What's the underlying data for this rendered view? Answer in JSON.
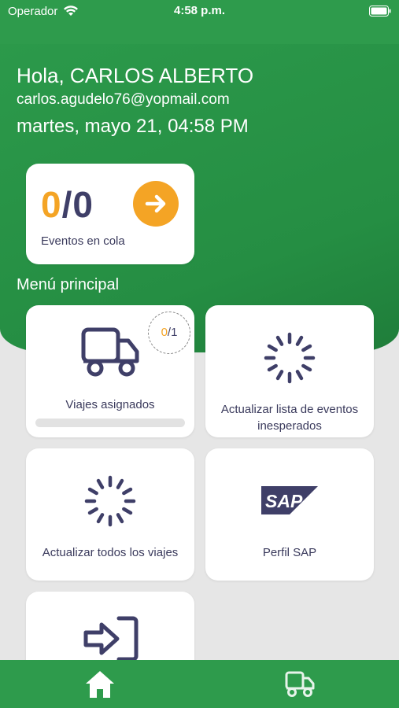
{
  "status_bar": {
    "carrier": "Operador",
    "time": "4:58 p.m."
  },
  "header": {
    "greeting": "Hola, CARLOS ALBERTO",
    "email": "carlos.agudelo76@yopmail.com",
    "datetime": "martes, mayo 21, 04:58 PM"
  },
  "queue": {
    "done": "0",
    "separator": "/",
    "total": "0",
    "label": "Eventos en cola",
    "action_icon": "arrow-right-icon"
  },
  "menu": {
    "title": "Menú principal",
    "tiles": [
      {
        "label": "Viajes asignados",
        "icon": "truck-icon",
        "badge_done": "0",
        "badge_sep": "/",
        "badge_total": "1",
        "progress": 0
      },
      {
        "label": "Actualizar lista de eventos inesperados",
        "icon": "spinner-icon"
      },
      {
        "label": "Actualizar todos los viajes",
        "icon": "spinner-icon"
      },
      {
        "label": "Perfil SAP",
        "icon": "sap-logo-icon",
        "logo_text": "SAP"
      },
      {
        "label": "",
        "icon": "sign-in-icon"
      }
    ]
  },
  "tabbar": {
    "items": [
      {
        "name": "home",
        "icon": "home-icon",
        "active": true
      },
      {
        "name": "trips",
        "icon": "truck-icon",
        "active": false
      }
    ]
  },
  "colors": {
    "primary_green": "#2e9b4c",
    "accent_orange": "#f4a425",
    "icon_navy": "#3f3f68",
    "background": "#e6e6e6"
  }
}
